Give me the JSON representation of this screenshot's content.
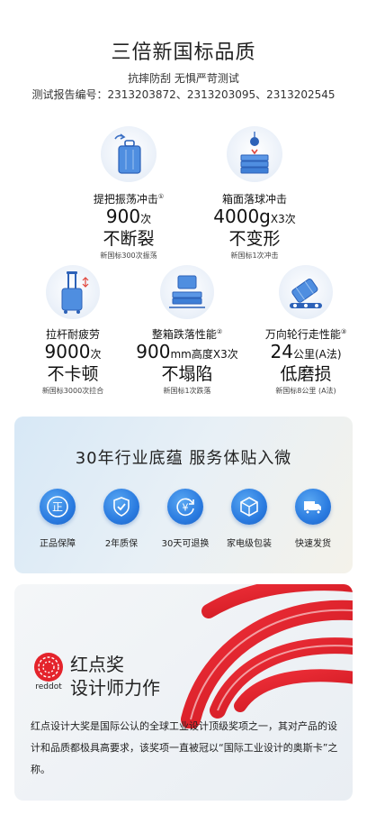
{
  "quality": {
    "title": "三倍新国标品质",
    "subtitle": "抗摔防刮 无惧严苛测试",
    "report": "测试报告编号：2313203872、2313203095、2313202545",
    "features": [
      {
        "label": "提把振荡冲击",
        "mark": "①",
        "value": "900",
        "unit": "次",
        "result": "不断裂",
        "note": "新国标300次振荡",
        "icon": "handle-shake-icon"
      },
      {
        "label": "箱面落球冲击",
        "mark": "",
        "value": "4000g",
        "unit": "X3次",
        "result": "不变形",
        "note": "新国标1次冲击",
        "icon": "ball-drop-icon"
      },
      {
        "label": "拉杆耐疲劳",
        "mark": "",
        "value": "9000",
        "unit": "次",
        "result": "不卡顿",
        "note": "新国标3000次拉合",
        "icon": "trolley-handle-icon"
      },
      {
        "label": "整箱跌落性能",
        "mark": "②",
        "value": "900",
        "unit": "mm高度X3次",
        "result": "不塌陷",
        "note": "新国标1次跌落",
        "icon": "case-drop-icon"
      },
      {
        "label": "万向轮行走性能",
        "mark": "③",
        "value": "24",
        "unit": "公里(A法)",
        "result": "低磨损",
        "note": "新国标8公里 (A法)",
        "icon": "wheel-walk-icon"
      }
    ]
  },
  "service": {
    "title": "30年行业底蕴  服务体贴入微",
    "items": [
      {
        "label": "正品保障",
        "icon": "authentic-icon",
        "glyph": "正"
      },
      {
        "label": "2年质保",
        "icon": "shield-check-icon",
        "glyph": "✓"
      },
      {
        "label": "30天可退换",
        "icon": "yuan-return-icon",
        "glyph": "¥"
      },
      {
        "label": "家电级包装",
        "icon": "package-box-icon",
        "glyph": "▣"
      },
      {
        "label": "快速发货",
        "icon": "delivery-truck-icon",
        "glyph": "▶"
      }
    ]
  },
  "reddot": {
    "logo_text": "reddot",
    "heading_line1": "红点奖",
    "heading_line2": "设计师力作",
    "description": "红点设计大奖是国际公认的全球工业设计顶级奖项之一，其对产品的设计和品质都极具高要求，该奖项一直被冠以“国际工业设计的奥斯卡”之称。"
  },
  "colors": {
    "accent_blue": "#2a7be0",
    "reddot_red": "#e4232b"
  }
}
